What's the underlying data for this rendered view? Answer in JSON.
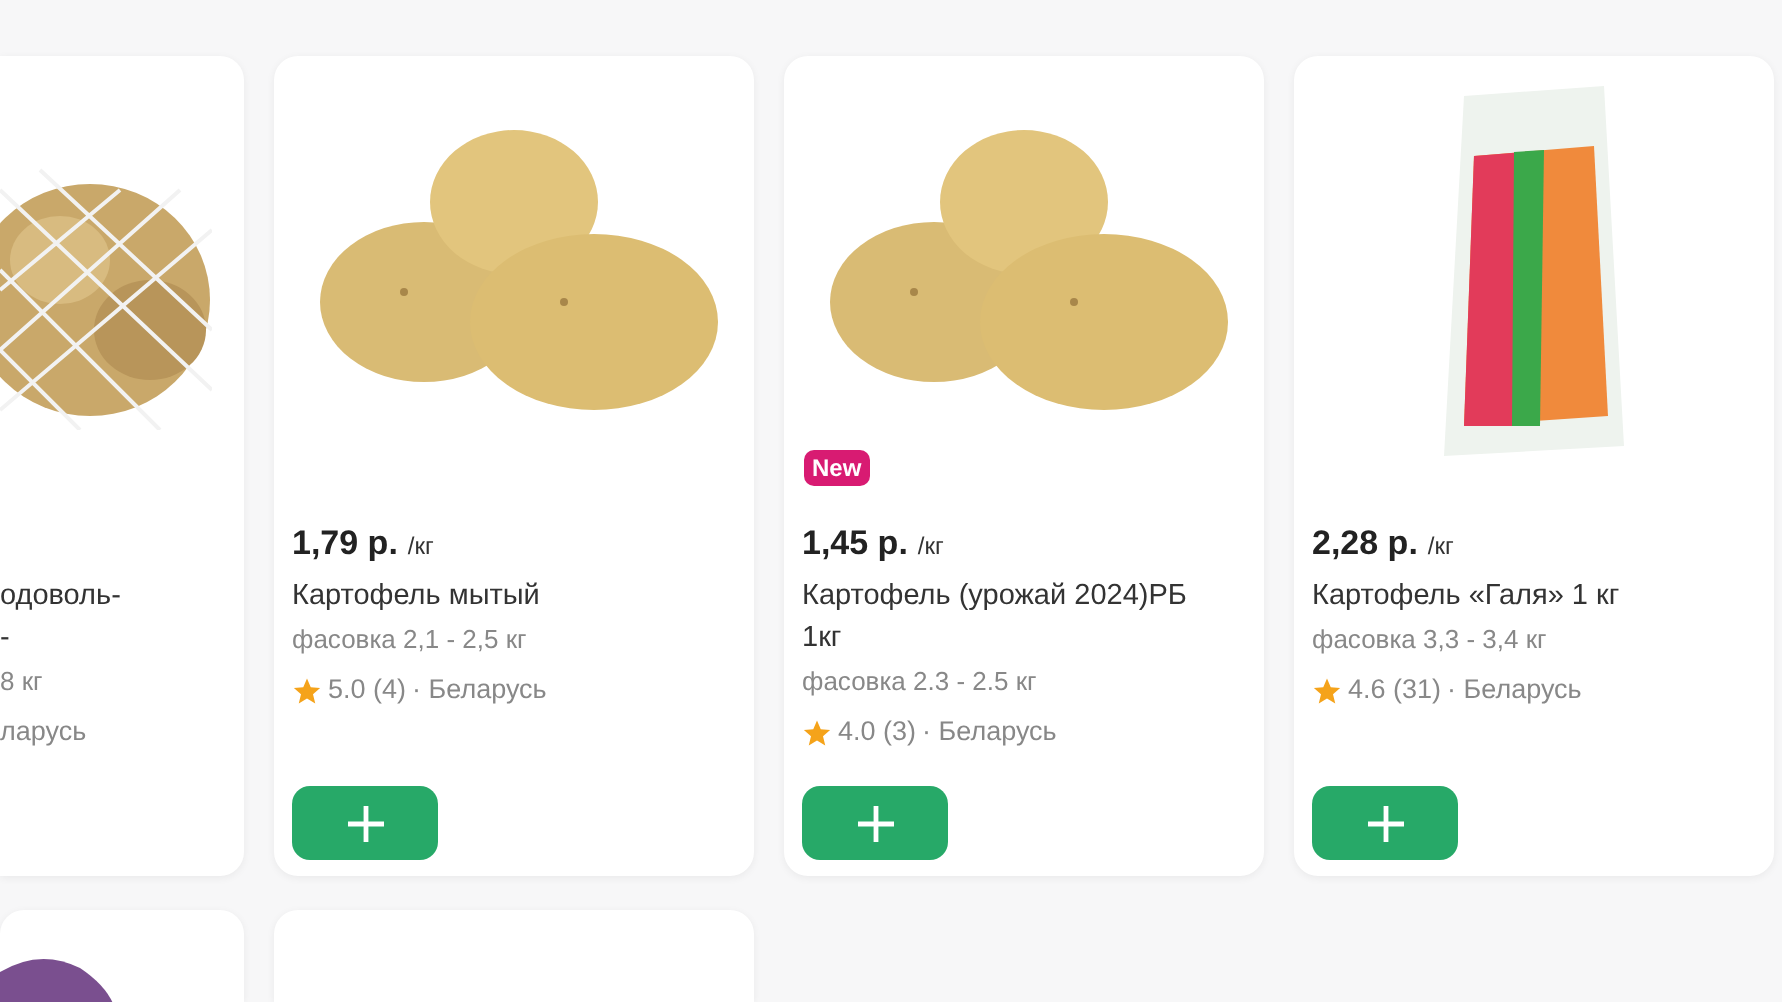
{
  "products": [
    {
      "kind": "net-bag",
      "name": "одоволь-\n-",
      "pack": "8 кг",
      "country": "ларусь"
    },
    {
      "kind": "potatoes",
      "price": "1,79 р.",
      "unit": "/кг",
      "name": "Картофель мытый",
      "pack": "фасовка 2,1 - 2,5 кг",
      "rating": "5.0 (4)",
      "country": "· Беларусь",
      "add": true
    },
    {
      "kind": "potatoes",
      "badge": "New",
      "price": "1,45 р.",
      "unit": "/кг",
      "name": "Картофель (урожай 2024)РБ 1кг",
      "pack": "фасовка 2.3 - 2.5 кг",
      "rating": "4.0 (3)",
      "country": "· Беларусь",
      "add": true
    },
    {
      "kind": "packet",
      "price": "2,28 р.",
      "unit": "/кг",
      "name": "Картофель «Галя» 1 кг",
      "pack": "фасовка 3,3 - 3,4 кг",
      "rating": "4.6 (31)",
      "country": "· Беларусь",
      "add": true
    }
  ],
  "next_row": [
    {
      "kind": "purple-photo"
    },
    {
      "kind": "blank"
    }
  ]
}
